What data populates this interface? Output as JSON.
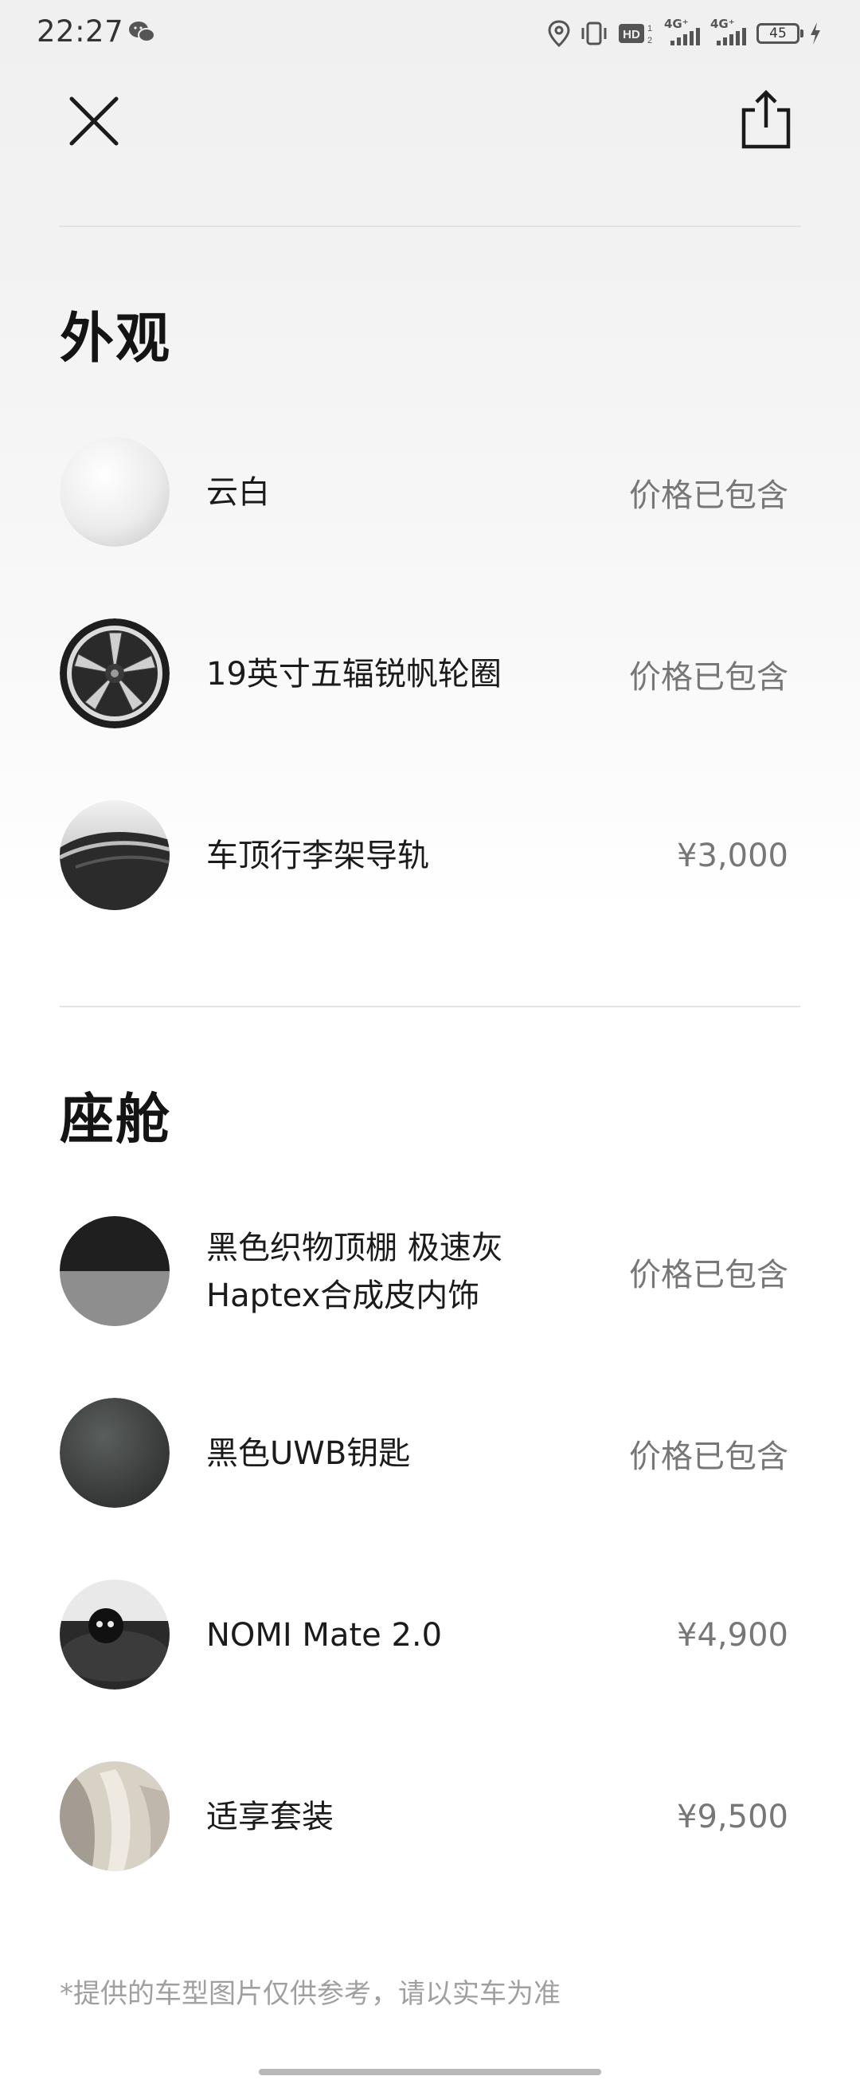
{
  "status_bar": {
    "time": "22:27",
    "battery": "45",
    "network_1": "4G⁺",
    "network_2": "4G⁺"
  },
  "sections": [
    {
      "title": "外观",
      "items": [
        {
          "name": "云白",
          "price": "价格已包含",
          "thumb": "cloud-white-paint"
        },
        {
          "name": "19英寸五辐锐帆轮圈",
          "price": "价格已包含",
          "thumb": "wheel"
        },
        {
          "name": "车顶行李架导轨",
          "price": "¥3,000",
          "thumb": "roof-rail"
        }
      ]
    },
    {
      "title": "座舱",
      "items": [
        {
          "name": "黑色织物顶棚 极速灰Haptex合成皮内饰",
          "price": "价格已包含",
          "thumb": "interior-black-grey"
        },
        {
          "name": "黑色UWB钥匙",
          "price": "价格已包含",
          "thumb": "uwb-key"
        },
        {
          "name": "NOMI Mate 2.0",
          "price": "¥4,900",
          "thumb": "nomi"
        },
        {
          "name": "适享套装",
          "price": "¥9,500",
          "thumb": "comfort-pack"
        }
      ]
    }
  ],
  "disclaimer": "*提供的车型图片仅供参考，请以实车为准",
  "colors": {
    "price_text": "#777777",
    "title_text": "#141414",
    "divider": "#e3e3e3"
  }
}
